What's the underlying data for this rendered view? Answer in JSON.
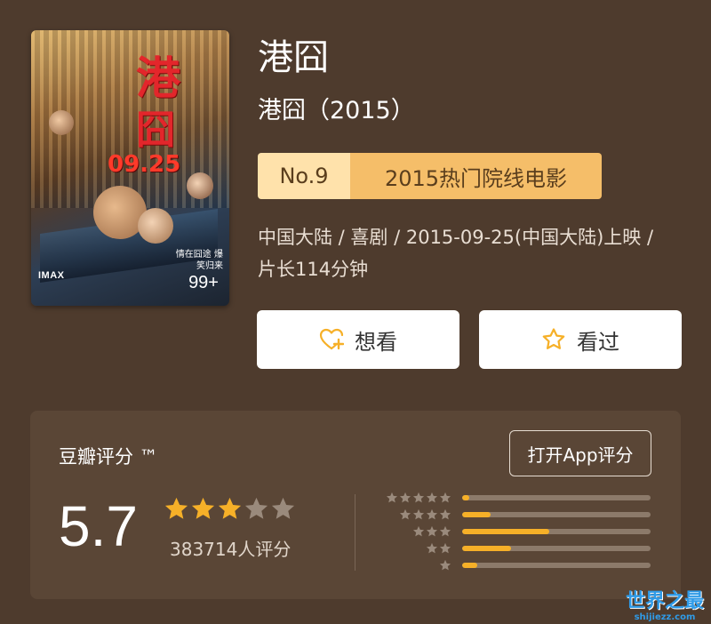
{
  "poster": {
    "title_chars": [
      "港",
      "囧"
    ],
    "date": "09.25",
    "imax": "IMAX",
    "tagline": "情在囧途 爆笑归来",
    "count_badge": "99+"
  },
  "movie": {
    "title": "港囧",
    "subtitle": "港囧（2015）",
    "rank_no": "No.9",
    "rank_label": "2015热门院线电影",
    "meta": "中国大陆 / 喜剧 / 2015-09-25(中国大陆)上映 / 片长114分钟"
  },
  "actions": {
    "want_label": "想看",
    "want_icon": "heart-plus-icon",
    "seen_label": "看过",
    "seen_icon": "star-outline-icon"
  },
  "rating": {
    "heading": "豆瓣评分 ™",
    "open_app_label": "打开App评分",
    "score": "5.7",
    "stars_filled": 3,
    "stars_total": 5,
    "count_text": "383714人评分",
    "distribution": [
      {
        "stars": 5,
        "fraction": 0.04
      },
      {
        "stars": 4,
        "fraction": 0.15
      },
      {
        "stars": 3,
        "fraction": 0.46
      },
      {
        "stars": 2,
        "fraction": 0.26
      },
      {
        "stars": 1,
        "fraction": 0.08
      }
    ],
    "colors": {
      "star_filled": "#f6b028",
      "star_empty": "#9a8a7c",
      "bar_fill": "#f6b028",
      "bar_track": "#8c7a6a"
    }
  },
  "watermark": {
    "title": "世界之最",
    "url": "shijiezz.com"
  }
}
